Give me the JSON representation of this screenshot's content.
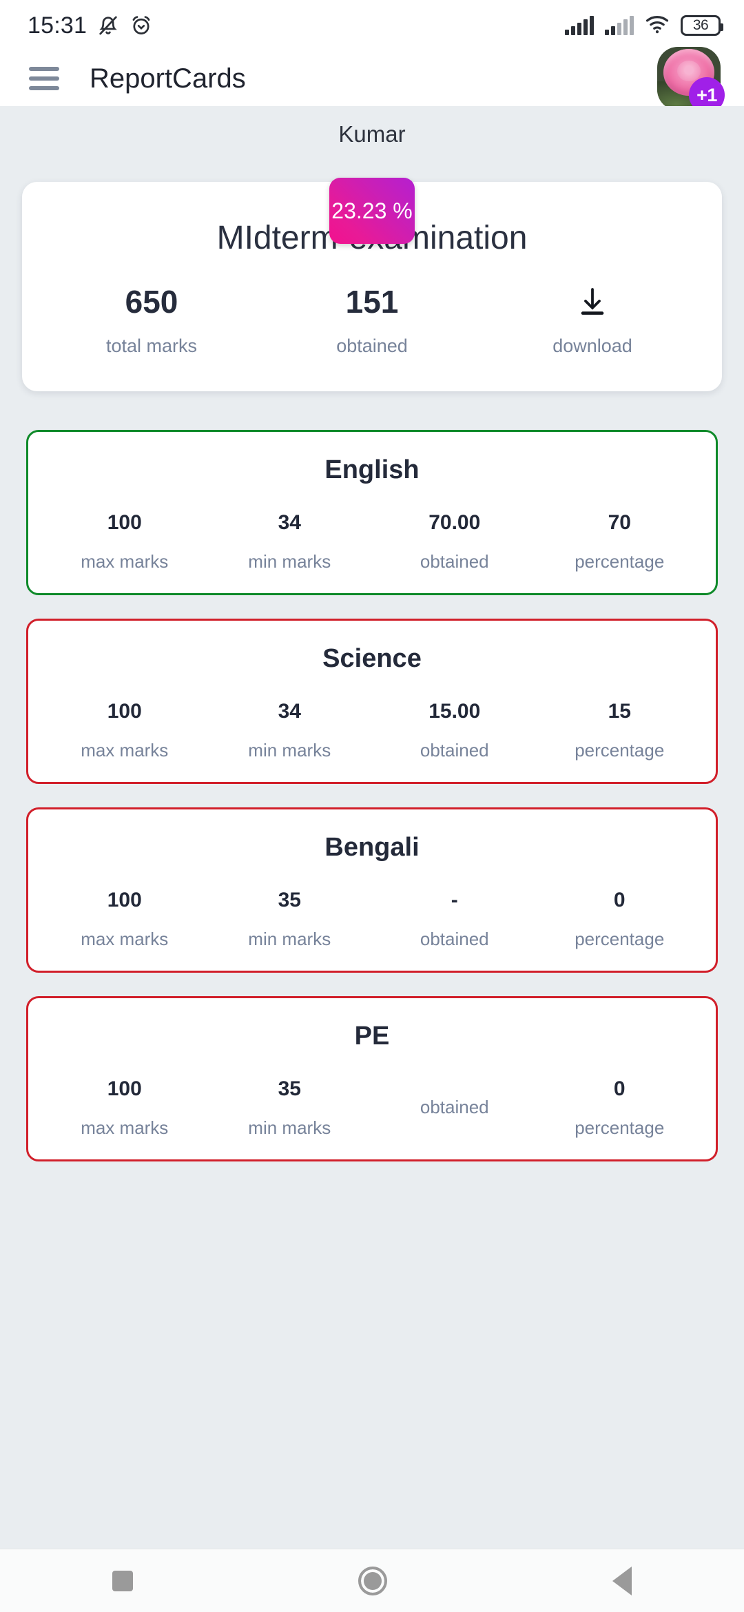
{
  "status_bar": {
    "time": "15:31",
    "battery_level": "36",
    "icons": [
      "bell-off-icon",
      "alarm-icon",
      "signal-icon",
      "signal-icon",
      "wifi-icon",
      "battery-icon"
    ]
  },
  "app_bar": {
    "title": "ReportCards",
    "menu_icon": "hamburger-icon",
    "avatar_badge": "+1"
  },
  "student": {
    "name": "Kumar"
  },
  "summary": {
    "percentage": "23.23 %",
    "exam_title": "MIdterm-examination",
    "stats": [
      {
        "value": "650",
        "label": "total marks"
      },
      {
        "value": "151",
        "label": "obtained"
      },
      {
        "value": "",
        "label": "download",
        "icon": "download-icon"
      }
    ]
  },
  "subjects": [
    {
      "name": "English",
      "status": "pass",
      "border_color": "#0f8a2a",
      "cells": [
        {
          "value": "100",
          "label": "max marks"
        },
        {
          "value": "34",
          "label": "min marks"
        },
        {
          "value": "70.00",
          "label": "obtained"
        },
        {
          "value": "70",
          "label": "percentage"
        }
      ]
    },
    {
      "name": "Science",
      "status": "fail",
      "border_color": "#d11f2a",
      "cells": [
        {
          "value": "100",
          "label": "max marks"
        },
        {
          "value": "34",
          "label": "min marks"
        },
        {
          "value": "15.00",
          "label": "obtained"
        },
        {
          "value": "15",
          "label": "percentage"
        }
      ]
    },
    {
      "name": "Bengali",
      "status": "fail",
      "border_color": "#d11f2a",
      "cells": [
        {
          "value": "100",
          "label": "max marks"
        },
        {
          "value": "35",
          "label": "min marks"
        },
        {
          "value": "-",
          "label": "obtained"
        },
        {
          "value": "0",
          "label": "percentage"
        }
      ]
    },
    {
      "name": "PE",
      "status": "fail",
      "border_color": "#d11f2a",
      "cells": [
        {
          "value": "100",
          "label": "max marks"
        },
        {
          "value": "35",
          "label": "min marks"
        },
        {
          "value": "",
          "label": "obtained"
        },
        {
          "value": "0",
          "label": "percentage"
        }
      ]
    }
  ],
  "nav_bar": {
    "recents": "recents-square-icon",
    "home": "home-circle-icon",
    "back": "back-triangle-icon"
  },
  "colors": {
    "background": "#e9edf0",
    "card": "#ffffff",
    "pass": "#0f8a2a",
    "fail": "#d11f2a",
    "accent_badge_start": "#f2118e",
    "accent_badge_end": "#b51fd0",
    "plus_badge": "#a020e8",
    "text_dark": "#242a3a",
    "text_muted": "#77839a"
  }
}
